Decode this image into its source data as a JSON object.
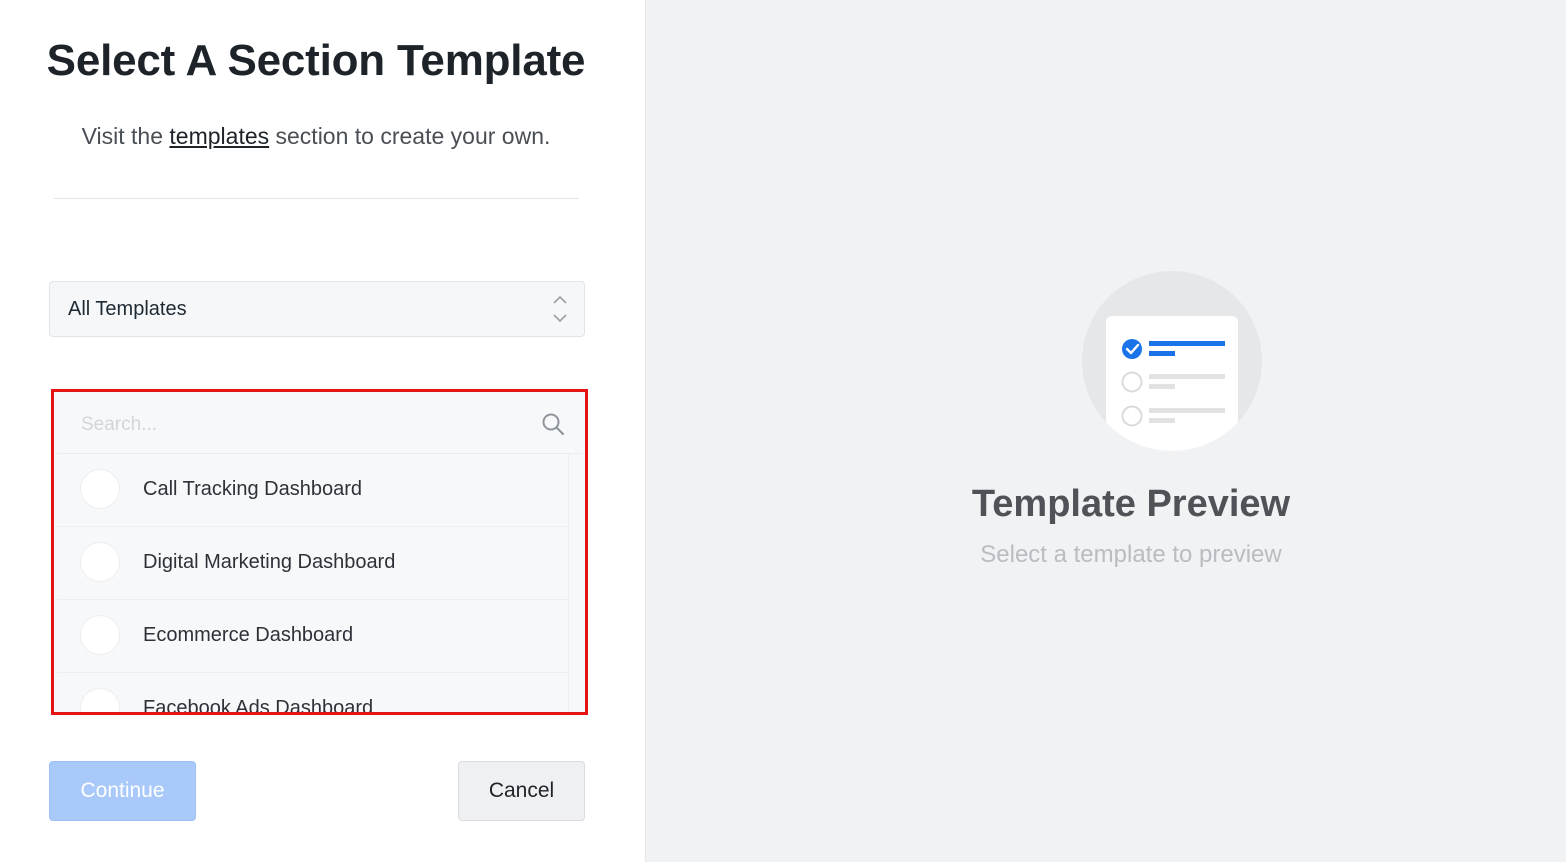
{
  "header": {
    "title": "Select A Section Template",
    "subtitle_before": "Visit the ",
    "subtitle_link": "templates",
    "subtitle_after": " section to create your own."
  },
  "filter": {
    "selected": "All Templates"
  },
  "search": {
    "placeholder": "Search...",
    "value": ""
  },
  "templates": [
    {
      "label": "Call Tracking Dashboard",
      "selected": false
    },
    {
      "label": "Digital Marketing Dashboard",
      "selected": false
    },
    {
      "label": "Ecommerce Dashboard",
      "selected": false
    },
    {
      "label": "Facebook Ads Dashboard",
      "selected": false
    }
  ],
  "actions": {
    "continue_label": "Continue",
    "continue_disabled": true,
    "cancel_label": "Cancel"
  },
  "preview": {
    "title": "Template Preview",
    "subtitle": "Select a template to preview"
  },
  "colors": {
    "accent": "#1a73e8",
    "continue_disabled_bg": "#a8c9f9",
    "highlight_border": "#e41414",
    "preview_bg": "#f1f2f4"
  },
  "icons": {
    "search": "search-icon",
    "select_arrows": "chevron-up-down-icon",
    "preview": "checklist-illustration-icon"
  }
}
